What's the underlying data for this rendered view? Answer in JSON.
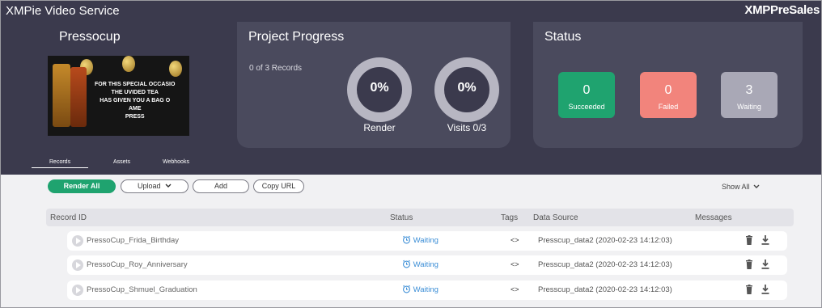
{
  "app": {
    "title": "XMPie Video Service",
    "user": "XMPPreSales"
  },
  "project": {
    "name": "Pressocup",
    "thumbnail_text": [
      "FOR THIS SPECIAL OCCASIO",
      "THE UVIDED TEA",
      "HAS GIVEN YOU A BAG O",
      "AME",
      "PRESS"
    ]
  },
  "progress": {
    "title": "Project Progress",
    "records": "0 of 3 Records",
    "render": {
      "value": "0%",
      "label": "Render"
    },
    "visits": {
      "value": "0%",
      "label": "Visits 0/3"
    }
  },
  "status": {
    "title": "Status",
    "succeeded": {
      "count": "0",
      "label": "Succeeded",
      "color": "#1fa36f"
    },
    "failed": {
      "count": "0",
      "label": "Failed",
      "color": "#f2847c"
    },
    "waiting": {
      "count": "3",
      "label": "Waiting",
      "color": "#a9a8b6"
    }
  },
  "tabs": [
    "Records",
    "Assets",
    "Webhooks"
  ],
  "toolbar": {
    "render_all": "Render All",
    "upload": "Upload",
    "add": "Add",
    "copy_url": "Copy URL",
    "show_all": "Show All"
  },
  "table": {
    "columns": [
      "Record ID",
      "Status",
      "Tags",
      "Data Source",
      "Messages"
    ],
    "rows": [
      {
        "id": "PressoCup_Frida_Birthday",
        "status": "Waiting",
        "tags": "<>",
        "source": "Presscup_data2 (2020-02-23 14:12:03)"
      },
      {
        "id": "PressoCup_Roy_Anniversary",
        "status": "Waiting",
        "tags": "<>",
        "source": "Presscup_data2 (2020-02-23 14:12:03)"
      },
      {
        "id": "PressoCup_Shmuel_Graduation",
        "status": "Waiting",
        "tags": "<>",
        "source": "Presscup_data2 (2020-02-23 14:12:03)"
      }
    ]
  }
}
